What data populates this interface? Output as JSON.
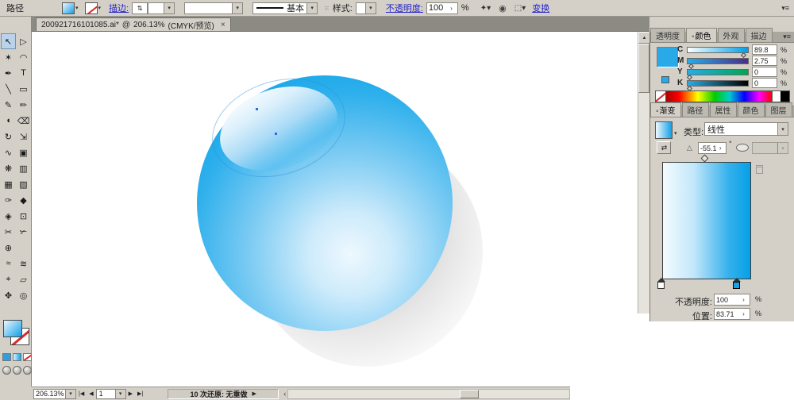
{
  "top_bar": {
    "selection_label": "路径",
    "stroke_label": "描边:",
    "brush_value": "基本",
    "style_label": "样式:",
    "opacity_label": "不透明度:",
    "opacity_value": "100",
    "percent": "%",
    "transform_label": "变换"
  },
  "doc_tab": {
    "title": "200921716101085.ai*",
    "at": "@",
    "zoom": "206.13%",
    "mode": "(CMYK/预览)"
  },
  "tools": [
    {
      "name": "selection",
      "glyph": "↖"
    },
    {
      "name": "direct-selection",
      "glyph": "▷"
    },
    {
      "name": "magic-wand",
      "glyph": "✶"
    },
    {
      "name": "lasso",
      "glyph": "◠"
    },
    {
      "name": "pen",
      "glyph": "✒"
    },
    {
      "name": "type",
      "glyph": "T"
    },
    {
      "name": "line",
      "glyph": "╲"
    },
    {
      "name": "rectangle",
      "glyph": "▭"
    },
    {
      "name": "paintbrush",
      "glyph": "✎"
    },
    {
      "name": "pencil",
      "glyph": "✏"
    },
    {
      "name": "blob-brush",
      "glyph": "◖"
    },
    {
      "name": "eraser",
      "glyph": "⌫"
    },
    {
      "name": "rotate",
      "glyph": "↻"
    },
    {
      "name": "scale",
      "glyph": "⇲"
    },
    {
      "name": "width",
      "glyph": "∿"
    },
    {
      "name": "free-transform",
      "glyph": "▣"
    },
    {
      "name": "symbol-sprayer",
      "glyph": "❋"
    },
    {
      "name": "graph",
      "glyph": "▥"
    },
    {
      "name": "mesh",
      "glyph": "▦"
    },
    {
      "name": "gradient",
      "glyph": "▨"
    },
    {
      "name": "eyedropper",
      "glyph": "✑"
    },
    {
      "name": "blend",
      "glyph": "◆"
    },
    {
      "name": "live-paint-bucket",
      "glyph": "◈"
    },
    {
      "name": "live-paint-selection",
      "glyph": "⊡"
    },
    {
      "name": "scissors",
      "glyph": "✂"
    },
    {
      "name": "knife",
      "glyph": "✃"
    },
    {
      "name": "artboard",
      "glyph": "⊕"
    },
    {
      "name": "empty",
      "glyph": ""
    },
    {
      "name": "liquify",
      "glyph": "≈"
    },
    {
      "name": "wrinkle",
      "glyph": "≋"
    },
    {
      "name": "target",
      "glyph": "⌖"
    },
    {
      "name": "measure",
      "glyph": "▱"
    },
    {
      "name": "hand",
      "glyph": "✥"
    },
    {
      "name": "zoom",
      "glyph": "◎"
    }
  ],
  "color_panel": {
    "tabs": [
      "透明度",
      "颜色",
      "外观",
      "描边"
    ],
    "active_tab": "颜色",
    "sliders": [
      {
        "label": "C",
        "value": "89.8",
        "pct": 90
      },
      {
        "label": "M",
        "value": "2.75",
        "pct": 3
      },
      {
        "label": "Y",
        "value": "0",
        "pct": 0
      },
      {
        "label": "K",
        "value": "0",
        "pct": 0
      }
    ],
    "unit": "%"
  },
  "gradient_panel": {
    "tabs": [
      "渐变",
      "路径",
      "属性",
      "颜色",
      "图层"
    ],
    "active_tab": "渐变",
    "type_label": "类型:",
    "type_value": "线性",
    "angle_value": "-55.1",
    "degree": "°",
    "opacity_label": "不透明度:",
    "opacity_value": "100",
    "position_label": "位置:",
    "position_value": "83.71",
    "unit": "%",
    "stop_position_pct": 84,
    "midpoint_pct": 50
  },
  "status_bar": {
    "zoom_value": "206.13%",
    "page_value": "1",
    "undo_text": "10 次还原: 无重做"
  },
  "icons": {
    "dropdown": "▾",
    "spinner": "›",
    "stepper": "⇅",
    "up": "▲",
    "first": "|◀",
    "prev": "◀",
    "next": "▶",
    "last": "▶|",
    "left_scroll": "‹",
    "play": "▶",
    "close": "×",
    "menu": "▾≡",
    "select_similar": "✦▾",
    "recolor": "◉",
    "align_box": "⬚▾",
    "reverse": "⇄",
    "angle": "△"
  },
  "colors": {
    "ball_blue": "#12a4e8",
    "ball_light": "#eef8fe",
    "shadow_gray": "#bdbdbd",
    "ui_gray": "#d4d0c8",
    "link_blue": "#2525cc",
    "cmyk_fill": "C89.8 M2.75 Y0 K0"
  }
}
